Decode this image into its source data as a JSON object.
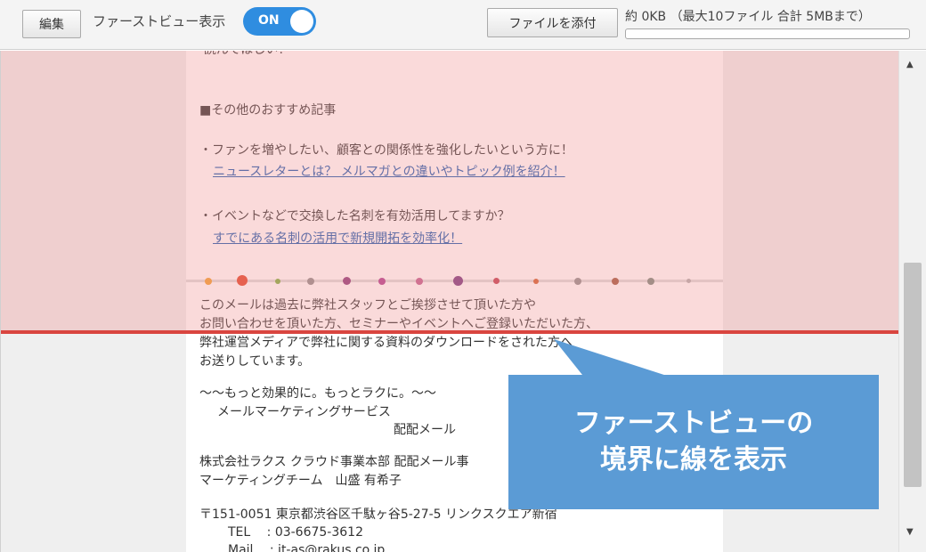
{
  "toolbar": {
    "edit_label": "編集",
    "first_view_label": "ファーストビュー表示",
    "toggle_state": "ON",
    "attach_label": "ファイルを添付",
    "size_info": "約 0KB （最大10ファイル 合計 5MBまで）",
    "attachment_usage_percent": 0,
    "toggle_color": "#2f8de0"
  },
  "mail": {
    "cut_top_text": "読んでほしい！",
    "recommend_heading": "■その他のおすすめ記事",
    "item1_text": "・ファンを増やしたい、顧客との関係性を強化したいという方に！",
    "item1_link": "ニュースレターとは？ メルマガとの違いやトピック例を紹介！",
    "item2_text": "・イベントなどで交換した名刺を有効活用してますか？",
    "item2_link": "すでにある名刺の活用で新規開拓を効率化！",
    "footer_lines": [
      "このメールは過去に弊社スタッフとご挨拶させて頂いた方や",
      "お問い合わせを頂いた方、セミナーやイベントへご登録いただいた方、",
      "弊社運営メディアで弊社に関する資料のダウンロードをされた方へ",
      "お送りしています。"
    ],
    "slogan": "～～もっと効果的に。もっとラクに。～～",
    "service_name": "メールマーケティングサービス",
    "product_name": "配配メール",
    "company_line1": "株式会社ラクス クラウド事業本部 配配メール事",
    "company_line2": "マーケティングチーム　山盛 有希子",
    "address": "〒151-0051 東京都渋谷区千駄ヶ谷5-27-5 リンクスクエア新宿",
    "tel": "TEL　 : 03-6675-3612",
    "mail_line": "Mail　 : it-as@rakus.co.jp"
  },
  "callout": {
    "line1": "ファーストビューの",
    "line2": "境界に線を表示"
  },
  "colors": {
    "boundary_line": "#d9453f",
    "callout_bg": "#5b9bd5",
    "link": "#1a5bb0"
  },
  "icons": {
    "scroll_up": "▲",
    "scroll_down": "▼"
  }
}
